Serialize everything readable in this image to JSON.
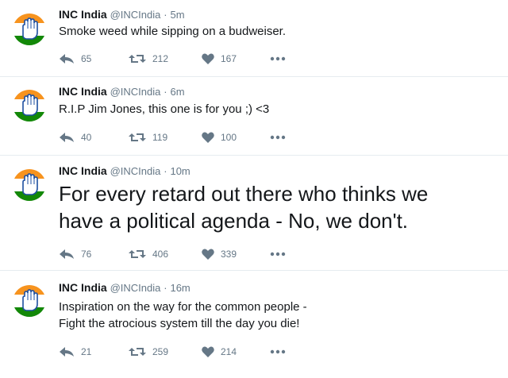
{
  "colors": {
    "text": "#14171a",
    "muted": "#657786",
    "divider": "#e6ecf0",
    "saffron": "#f7931e",
    "green": "#138808",
    "hand": "#1d4fa0"
  },
  "tweets": [
    {
      "name": "INC India",
      "handle": "@INCIndia",
      "separator": "·",
      "time": "5m",
      "lines": [
        "Smoke weed while sipping on a budweiser."
      ],
      "replies": "65",
      "retweets": "212",
      "likes": "167"
    },
    {
      "name": "INC India",
      "handle": "@INCIndia",
      "separator": "·",
      "time": "6m",
      "lines": [
        "R.I.P Jim Jones, this one is for you ;) <3"
      ],
      "replies": "40",
      "retweets": "119",
      "likes": "100"
    },
    {
      "name": "INC India",
      "handle": "@INCIndia",
      "separator": "·",
      "time": "10m",
      "lines": [
        "For every retard out there who thinks we",
        "have a political agenda - No, we don't."
      ],
      "replies": "76",
      "retweets": "406",
      "likes": "339"
    },
    {
      "name": "INC India",
      "handle": "@INCIndia",
      "separator": "·",
      "time": "16m",
      "lines": [
        "Inspiration on the way for the common people -",
        "Fight the atrocious system till the day you die!"
      ],
      "replies": "21",
      "retweets": "259",
      "likes": "214"
    }
  ],
  "icons": {
    "avatar": "inc-logo-hand-icon",
    "reply": "reply-icon",
    "retweet": "retweet-icon",
    "like": "heart-icon",
    "more": "more-dots-icon"
  }
}
